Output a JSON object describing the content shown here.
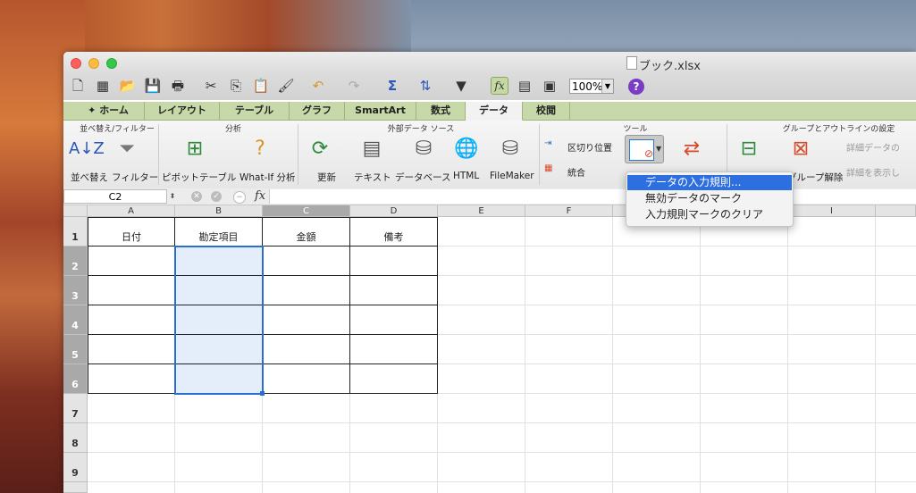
{
  "window": {
    "title": "ブック.xlsx"
  },
  "toolbar": {
    "zoom": "100%"
  },
  "tabs": [
    "ホーム",
    "レイアウト",
    "テーブル",
    "グラフ",
    "SmartArt",
    "数式",
    "データ",
    "校閲"
  ],
  "active_tab": "データ",
  "ribbon": {
    "groups": {
      "sort_filter": "並べ替え/フィルター",
      "analysis": "分析",
      "external": "外部データ ソース",
      "tools": "ツール",
      "outline": "グループとアウトラインの設定"
    },
    "sort": "並べ替え",
    "filter": "フィルター",
    "pivot": "ピボットテーブル",
    "whatif": "What-If 分析",
    "refresh": "更新",
    "text": "テキスト",
    "database": "データベース",
    "html": "HTML",
    "filemaker": "FileMaker",
    "text_to_columns": "区切り位置",
    "consolidate": "統合",
    "ungroup": "グループ解除",
    "detail_data": "詳細データの",
    "show_detail": "詳細を表示し"
  },
  "formula_bar": {
    "name_box": "C2",
    "fx": "fx",
    "formula": ""
  },
  "columns": [
    "A",
    "B",
    "C",
    "D",
    "E",
    "F",
    "G",
    "H",
    "I"
  ],
  "rows": [
    "1",
    "2",
    "3",
    "4",
    "5",
    "6",
    "7",
    "8",
    "9"
  ],
  "table_headers": [
    "日付",
    "勘定項目",
    "金額",
    "備考"
  ],
  "menu": {
    "items": [
      "データの入力規則...",
      "無効データのマーク",
      "入力規則マークのクリア"
    ]
  },
  "colors": {
    "ribbon_tab": "#c7d9a8",
    "selection": "#2a6fcf",
    "menu_highlight": "#2d6ee0"
  }
}
